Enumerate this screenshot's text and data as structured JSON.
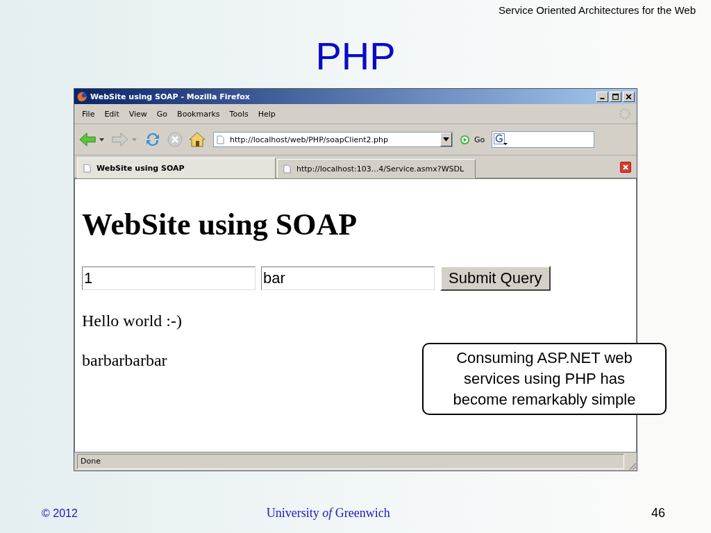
{
  "slide": {
    "header": "Service Oriented Architectures for the Web",
    "title": "PHP",
    "callout": "Consuming ASP.NET web services using PHP has become remarkably simple",
    "footer": {
      "copyright": "© 2012",
      "university": "University *of* Greenwich",
      "page": "46"
    }
  },
  "window": {
    "title": "WebSite using SOAP - Mozilla Firefox"
  },
  "menu": [
    "File",
    "Edit",
    "View",
    "Go",
    "Bookmarks",
    "Tools",
    "Help"
  ],
  "toolbar": {
    "address": "http://localhost/web/PHP/soapClient2.php",
    "go": "Go"
  },
  "tabs": [
    {
      "label": "WebSite using SOAP",
      "selected": true
    },
    {
      "label": "http://localhost:103...4/Service.asmx?WSDL",
      "selected": false
    }
  ],
  "page": {
    "heading": "WebSite using SOAP",
    "fields": [
      {
        "value": "1"
      },
      {
        "value": "bar"
      }
    ],
    "submit": "Submit Query",
    "outputs": [
      "Hello world :-)",
      "barbarbarbar"
    ]
  },
  "status_bar": "Done"
}
